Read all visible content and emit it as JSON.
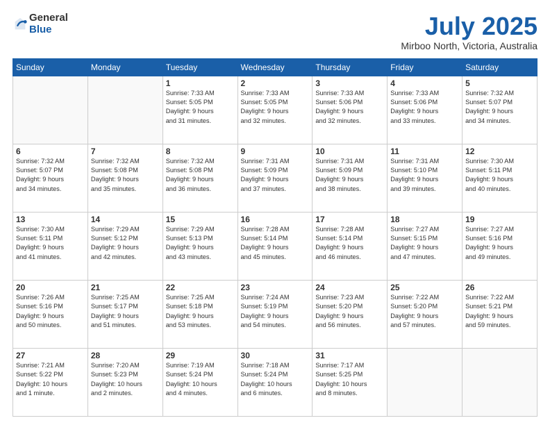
{
  "header": {
    "logo_general": "General",
    "logo_blue": "Blue",
    "month_title": "July 2025",
    "location": "Mirboo North, Victoria, Australia"
  },
  "weekdays": [
    "Sunday",
    "Monday",
    "Tuesday",
    "Wednesday",
    "Thursday",
    "Friday",
    "Saturday"
  ],
  "weeks": [
    [
      {
        "day": "",
        "info": ""
      },
      {
        "day": "",
        "info": ""
      },
      {
        "day": "1",
        "info": "Sunrise: 7:33 AM\nSunset: 5:05 PM\nDaylight: 9 hours\nand 31 minutes."
      },
      {
        "day": "2",
        "info": "Sunrise: 7:33 AM\nSunset: 5:05 PM\nDaylight: 9 hours\nand 32 minutes."
      },
      {
        "day": "3",
        "info": "Sunrise: 7:33 AM\nSunset: 5:06 PM\nDaylight: 9 hours\nand 32 minutes."
      },
      {
        "day": "4",
        "info": "Sunrise: 7:33 AM\nSunset: 5:06 PM\nDaylight: 9 hours\nand 33 minutes."
      },
      {
        "day": "5",
        "info": "Sunrise: 7:32 AM\nSunset: 5:07 PM\nDaylight: 9 hours\nand 34 minutes."
      }
    ],
    [
      {
        "day": "6",
        "info": "Sunrise: 7:32 AM\nSunset: 5:07 PM\nDaylight: 9 hours\nand 34 minutes."
      },
      {
        "day": "7",
        "info": "Sunrise: 7:32 AM\nSunset: 5:08 PM\nDaylight: 9 hours\nand 35 minutes."
      },
      {
        "day": "8",
        "info": "Sunrise: 7:32 AM\nSunset: 5:08 PM\nDaylight: 9 hours\nand 36 minutes."
      },
      {
        "day": "9",
        "info": "Sunrise: 7:31 AM\nSunset: 5:09 PM\nDaylight: 9 hours\nand 37 minutes."
      },
      {
        "day": "10",
        "info": "Sunrise: 7:31 AM\nSunset: 5:09 PM\nDaylight: 9 hours\nand 38 minutes."
      },
      {
        "day": "11",
        "info": "Sunrise: 7:31 AM\nSunset: 5:10 PM\nDaylight: 9 hours\nand 39 minutes."
      },
      {
        "day": "12",
        "info": "Sunrise: 7:30 AM\nSunset: 5:11 PM\nDaylight: 9 hours\nand 40 minutes."
      }
    ],
    [
      {
        "day": "13",
        "info": "Sunrise: 7:30 AM\nSunset: 5:11 PM\nDaylight: 9 hours\nand 41 minutes."
      },
      {
        "day": "14",
        "info": "Sunrise: 7:29 AM\nSunset: 5:12 PM\nDaylight: 9 hours\nand 42 minutes."
      },
      {
        "day": "15",
        "info": "Sunrise: 7:29 AM\nSunset: 5:13 PM\nDaylight: 9 hours\nand 43 minutes."
      },
      {
        "day": "16",
        "info": "Sunrise: 7:28 AM\nSunset: 5:14 PM\nDaylight: 9 hours\nand 45 minutes."
      },
      {
        "day": "17",
        "info": "Sunrise: 7:28 AM\nSunset: 5:14 PM\nDaylight: 9 hours\nand 46 minutes."
      },
      {
        "day": "18",
        "info": "Sunrise: 7:27 AM\nSunset: 5:15 PM\nDaylight: 9 hours\nand 47 minutes."
      },
      {
        "day": "19",
        "info": "Sunrise: 7:27 AM\nSunset: 5:16 PM\nDaylight: 9 hours\nand 49 minutes."
      }
    ],
    [
      {
        "day": "20",
        "info": "Sunrise: 7:26 AM\nSunset: 5:16 PM\nDaylight: 9 hours\nand 50 minutes."
      },
      {
        "day": "21",
        "info": "Sunrise: 7:25 AM\nSunset: 5:17 PM\nDaylight: 9 hours\nand 51 minutes."
      },
      {
        "day": "22",
        "info": "Sunrise: 7:25 AM\nSunset: 5:18 PM\nDaylight: 9 hours\nand 53 minutes."
      },
      {
        "day": "23",
        "info": "Sunrise: 7:24 AM\nSunset: 5:19 PM\nDaylight: 9 hours\nand 54 minutes."
      },
      {
        "day": "24",
        "info": "Sunrise: 7:23 AM\nSunset: 5:20 PM\nDaylight: 9 hours\nand 56 minutes."
      },
      {
        "day": "25",
        "info": "Sunrise: 7:22 AM\nSunset: 5:20 PM\nDaylight: 9 hours\nand 57 minutes."
      },
      {
        "day": "26",
        "info": "Sunrise: 7:22 AM\nSunset: 5:21 PM\nDaylight: 9 hours\nand 59 minutes."
      }
    ],
    [
      {
        "day": "27",
        "info": "Sunrise: 7:21 AM\nSunset: 5:22 PM\nDaylight: 10 hours\nand 1 minute."
      },
      {
        "day": "28",
        "info": "Sunrise: 7:20 AM\nSunset: 5:23 PM\nDaylight: 10 hours\nand 2 minutes."
      },
      {
        "day": "29",
        "info": "Sunrise: 7:19 AM\nSunset: 5:24 PM\nDaylight: 10 hours\nand 4 minutes."
      },
      {
        "day": "30",
        "info": "Sunrise: 7:18 AM\nSunset: 5:24 PM\nDaylight: 10 hours\nand 6 minutes."
      },
      {
        "day": "31",
        "info": "Sunrise: 7:17 AM\nSunset: 5:25 PM\nDaylight: 10 hours\nand 8 minutes."
      },
      {
        "day": "",
        "info": ""
      },
      {
        "day": "",
        "info": ""
      }
    ]
  ]
}
